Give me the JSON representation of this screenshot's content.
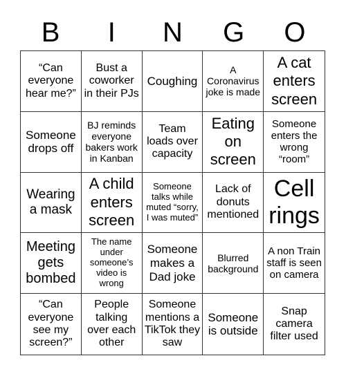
{
  "header": {
    "letters": [
      "B",
      "I",
      "N",
      "G",
      "O"
    ]
  },
  "cells": [
    "“Can everyone hear me?”",
    "Bust a coworker in their PJs",
    "Coughing",
    "A Coronavirus joke is made",
    "A cat enters screen",
    "Someone drops off",
    "BJ reminds everyone bakers work in Kanban",
    "Team loads over capacity",
    "Eating on screen",
    "Someone enters the wrong “room”",
    "Wearing a mask",
    "A child enters screen",
    "Someone talks while muted “sorry, I was muted”",
    "Lack of donuts mentioned",
    "Cell rings",
    "Meeting gets bombed",
    "The name under someone’s video is wrong",
    "Someone makes a Dad joke",
    "Blurred background",
    "A non Train staff is seen on camera",
    "“Can everyone see my screen?”",
    "People talking over each other",
    "Someone mentions a TikTok they saw",
    "Someone is outside",
    "Snap camera filter used"
  ]
}
